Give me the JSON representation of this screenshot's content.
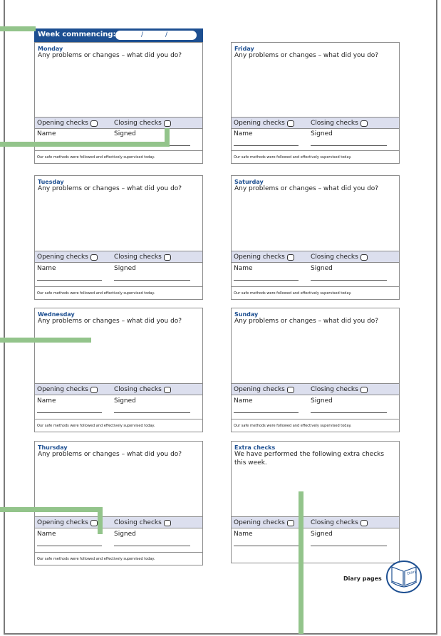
{
  "header": {
    "week_label": "Week commencing:",
    "date_sep1": "/",
    "date_sep2": "/"
  },
  "days": [
    {
      "title": "Monday",
      "question": "Any problems or changes – what did you do?"
    },
    {
      "title": "Tuesday",
      "question": "Any problems or changes – what did you do?"
    },
    {
      "title": "Wednesday",
      "question": "Any problems or changes – what did you do?"
    },
    {
      "title": "Thursday",
      "question": "Any problems or changes – what did you do?"
    },
    {
      "title": "Friday",
      "question": "Any problems or changes – what did you do?"
    },
    {
      "title": "Saturday",
      "question": "Any problems or changes – what did you do?"
    },
    {
      "title": "Sunday",
      "question": "Any problems or changes – what did you do?"
    },
    {
      "title": "Extra checks",
      "question": "We have performed the following extra checks this week."
    }
  ],
  "labels": {
    "opening_checks": "Opening checks",
    "closing_checks": "Closing checks",
    "name": "Name",
    "signed": "Signed",
    "footer": "Our safe methods were followed and effectively supervised today."
  },
  "footer": {
    "diary_pages": "Diary pages",
    "badge_text": "Diary"
  },
  "colors": {
    "accent_blue": "#1d4f91",
    "checks_band": "#dcdfee",
    "green_marker": "#93c48b",
    "frame_grey": "#7a7a7a"
  }
}
